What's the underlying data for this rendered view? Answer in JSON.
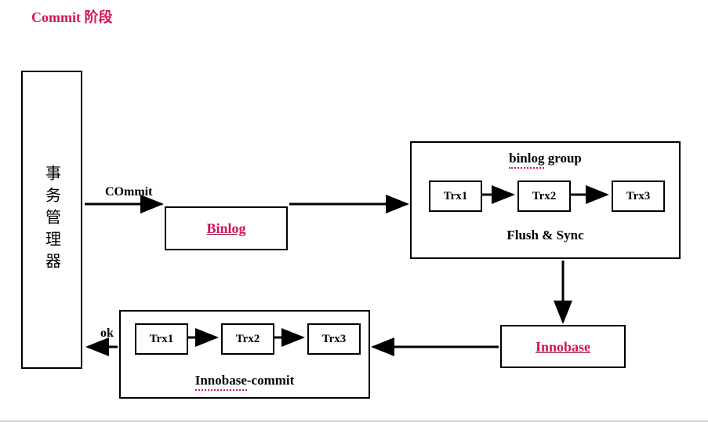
{
  "title": "Commit  阶段",
  "txn_manager": "事务管理器",
  "commit_label": "COmmit",
  "ok_label": "ok",
  "binlog": {
    "label": "Binlog"
  },
  "binlog_group": {
    "title_plain": "binlog",
    "title_after": " group",
    "footer": "Flush & Sync",
    "trx": [
      "Trx1",
      "Trx2",
      "Trx3"
    ]
  },
  "innobase": {
    "label": "Innobase"
  },
  "innobase_commit": {
    "title_underlined": "Innobase",
    "title_after": "-commit",
    "trx": [
      "Trx1",
      "Trx2",
      "Trx3"
    ]
  }
}
